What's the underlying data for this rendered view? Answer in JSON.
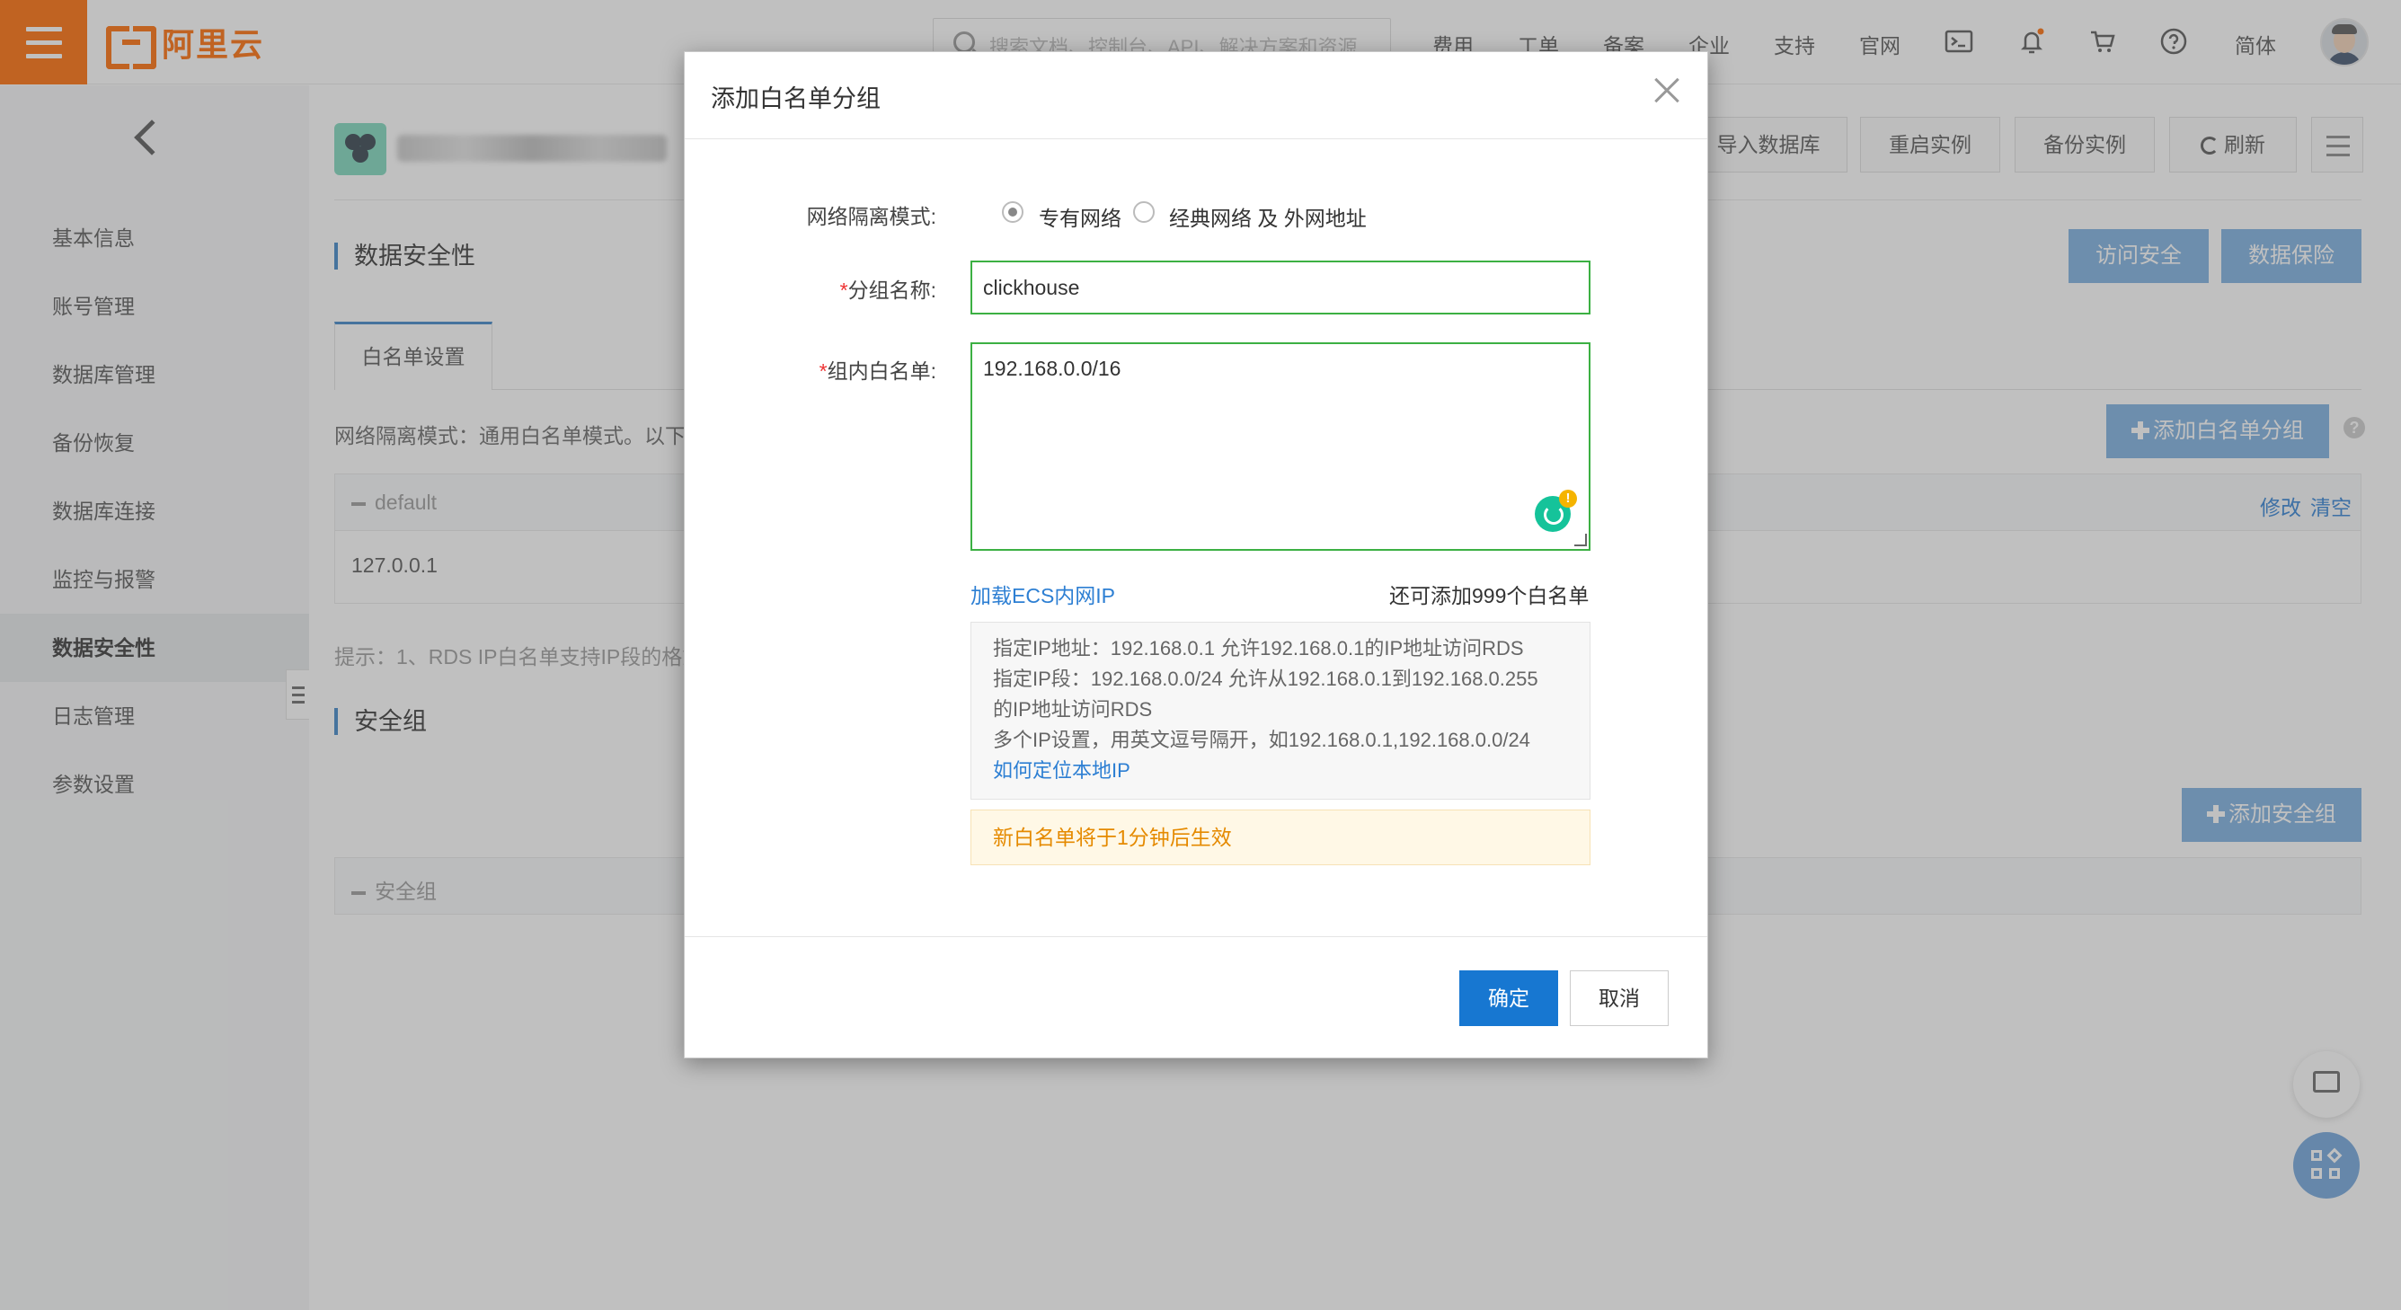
{
  "header": {
    "logo_text": "阿里云",
    "search_placeholder": "搜索文档、控制台、API、解决方案和资源",
    "nav": [
      "费用",
      "工单",
      "备案",
      "企业",
      "支持",
      "官网"
    ],
    "lang": "简体"
  },
  "sidebar": {
    "items": [
      {
        "label": "基本信息"
      },
      {
        "label": "账号管理"
      },
      {
        "label": "数据库管理"
      },
      {
        "label": "备份恢复"
      },
      {
        "label": "数据库连接"
      },
      {
        "label": "监控与报警"
      },
      {
        "label": "数据安全性"
      },
      {
        "label": "日志管理"
      },
      {
        "label": "参数设置"
      }
    ]
  },
  "toolbar": {
    "import_db": "导入数据库",
    "restart": "重启实例",
    "backup": "备份实例",
    "refresh": "刷新"
  },
  "main": {
    "section_title": "数据安全性",
    "access_security": "访问安全",
    "data_protection": "数据保险",
    "tab_whitelist": "白名单设置",
    "add_group_btn": "添加白名单分组",
    "mode_text": "网络隔离模式：通用白名单模式。以下",
    "group_default": "default",
    "group_actions": {
      "edit": "修改",
      "clear": "清空"
    },
    "group_ip": "127.0.0.1",
    "tip_text": "提示：1、RDS IP白名单支持IP段的格式",
    "security_group_title": "安全组",
    "add_security_group_btn": "添加安全组",
    "security_group_header": "安全组"
  },
  "modal": {
    "title": "添加白名单分组",
    "network_mode_label": "网络隔离模式:",
    "network_options": [
      "专有网络",
      "经典网络 及 外网地址"
    ],
    "group_name_label": "分组名称:",
    "group_name_value": "clickhouse",
    "whitelist_label": "组内白名单:",
    "whitelist_value": "192.168.0.0/16",
    "load_ecs_link": "加载ECS内网IP",
    "remaining": "还可添加999个白名单",
    "hints": [
      "指定IP地址：192.168.0.1 允许192.168.0.1的IP地址访问RDS",
      "指定IP段：192.168.0.0/24 允许从192.168.0.1到192.168.0.255",
      "的IP地址访问RDS",
      "多个IP设置，用英文逗号隔开，如192.168.0.1,192.168.0.0/24"
    ],
    "locate_ip_link": "如何定位本地IP",
    "warning": "新白名单将于1分钟后生效",
    "confirm": "确定",
    "cancel": "取消"
  }
}
